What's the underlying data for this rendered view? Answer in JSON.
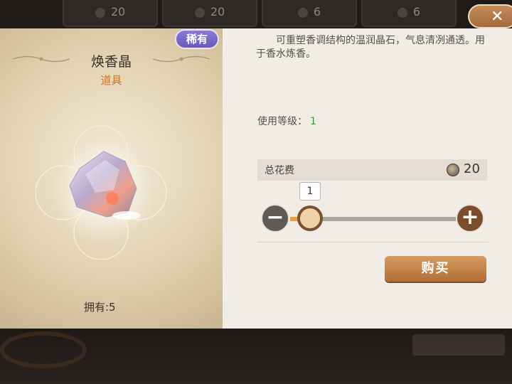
{
  "background": {
    "shop_cards": [
      {
        "price": "20"
      },
      {
        "price": "20"
      },
      {
        "price": "6"
      },
      {
        "price": "6"
      }
    ]
  },
  "item": {
    "rarity": "稀有",
    "name": "焕香晶",
    "type": "道具",
    "owned_label": "拥有:5"
  },
  "details": {
    "description": "可重塑香调结构的温润晶石，气息清冽通透。用于香水炼香。",
    "level_label": "使用等级：",
    "level_value": "1",
    "cost_label": "总花费",
    "cost_value": "20"
  },
  "quantity": {
    "value": "1",
    "minus_icon": "minus-icon",
    "plus_icon": "plus-icon"
  },
  "buttons": {
    "buy_label": "购买",
    "close_icon": "close-icon"
  },
  "colors": {
    "rarity": "#7a68c6",
    "item_type": "#d2711f",
    "level_value": "#2fa12f",
    "buy_button": "#c2834a"
  }
}
